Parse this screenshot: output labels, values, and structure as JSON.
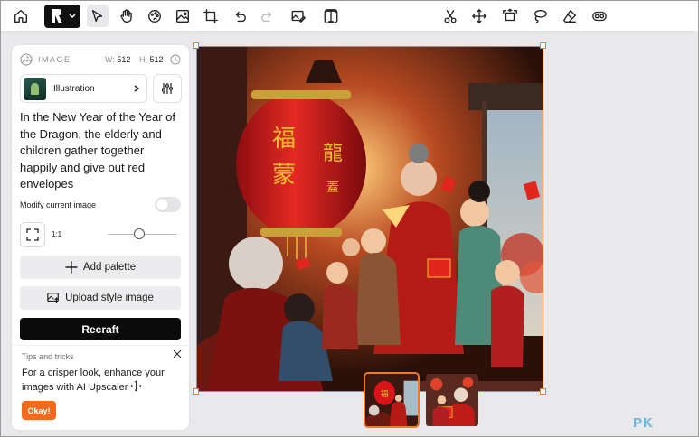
{
  "toolbar": {
    "tools": [
      {
        "name": "home-icon"
      },
      {
        "name": "select-pointer-icon"
      },
      {
        "name": "hand-icon"
      },
      {
        "name": "palette-icon"
      },
      {
        "name": "image-frame-icon"
      },
      {
        "name": "crop-frame-icon"
      },
      {
        "name": "undo-icon"
      },
      {
        "name": "redo-icon"
      },
      {
        "name": "image-edit-icon"
      },
      {
        "name": "text-tool-icon"
      },
      {
        "name": "scissors-icon"
      },
      {
        "name": "move-arrows-icon"
      },
      {
        "name": "crop-expand-icon"
      },
      {
        "name": "lasso-icon"
      },
      {
        "name": "eraser-icon"
      },
      {
        "name": "vectorize-icon"
      }
    ]
  },
  "panel": {
    "section_label": "IMAGE",
    "width_label": "W:",
    "width_value": "512",
    "height_label": "H:",
    "height_value": "512",
    "style_name": "Illustration",
    "prompt": "In the New Year of the Year of the Dragon, the elderly and children gather together happily and give out red envelopes",
    "modify_label": "Modify current image",
    "modify_enabled": false,
    "aspect_ratio": "1:1",
    "add_palette_label": "Add palette",
    "upload_style_label": "Upload style image",
    "recraft_label": "Recraft"
  },
  "tips": {
    "title": "Tips and tricks",
    "body": "For a crisper look, enhance your images with AI Upscaler",
    "okay_label": "Okay!"
  },
  "canvas": {
    "lantern_text_left": "福 蒙",
    "lantern_text_right": "龍 蓋"
  },
  "thumbnails": {
    "selected_index": 0,
    "count": 2
  },
  "watermark": "PK",
  "colors": {
    "accent": "#f07a2a",
    "okay_button": "#f26b1d",
    "recraft_button": "#0b0b0b",
    "lantern_red": "#d9141b",
    "lantern_gold": "#f2c12e"
  }
}
